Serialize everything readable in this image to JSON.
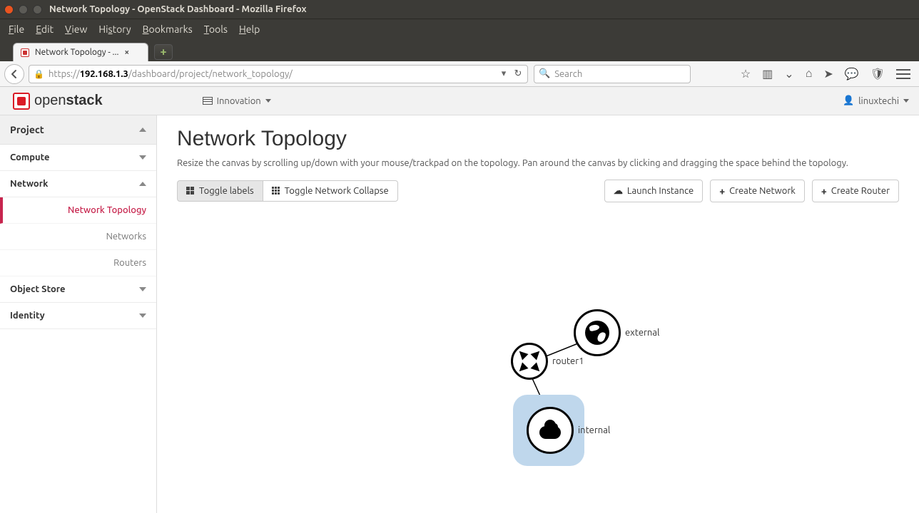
{
  "os": {
    "title": "Network Topology - OpenStack Dashboard - Mozilla Firefox"
  },
  "firefox": {
    "menu": {
      "file": "File",
      "edit": "Edit",
      "view": "View",
      "history": "History",
      "bookmarks": "Bookmarks",
      "tools": "Tools",
      "help": "Help"
    },
    "tab_title": "Network Topology - ...",
    "url_prefix": "https://",
    "url_host": "192.168.1.3",
    "url_path": "/dashboard/project/network_topology/",
    "search_placeholder": "Search"
  },
  "appbar": {
    "brand1": "open",
    "brand2": "stack",
    "project": "Innovation",
    "user": "linuxtechi"
  },
  "sidebar": {
    "project": "Project",
    "compute": "Compute",
    "network": "Network",
    "object_store": "Object Store",
    "identity": "Identity",
    "items": {
      "network_topology": "Network Topology",
      "networks": "Networks",
      "routers": "Routers"
    }
  },
  "main": {
    "title": "Network Topology",
    "hint": "Resize the canvas by scrolling up/down with your mouse/trackpad on the topology. Pan around the canvas by clicking and dragging the space behind the topology.",
    "toggle_labels": "Toggle labels",
    "toggle_collapse": "Toggle Network Collapse",
    "launch_instance": "Launch Instance",
    "create_network": "Create Network",
    "create_router": "Create Router"
  },
  "topology": {
    "external": "external",
    "router": "router1",
    "internal": "internal"
  }
}
